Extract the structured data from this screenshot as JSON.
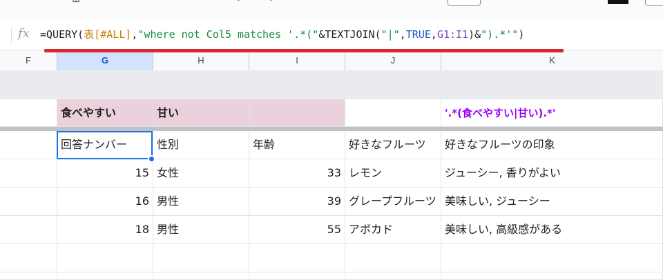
{
  "formula_bar": {
    "fx": "fx",
    "formula_parts": {
      "p1": "=QUERY(",
      "p2": "表[#ALL]",
      "p3": ",",
      "p4": "\"where not Col5 matches '.*(\"",
      "p5": "&TEXTJOIN(",
      "p6": "\"|\"",
      "p7": ",",
      "p8": "TRUE",
      "p9": ",",
      "p10": "G1:I1",
      "p11": ")&",
      "p12": "\").*'\"",
      "p13": ")"
    }
  },
  "columns": [
    "F",
    "G",
    "H",
    "I",
    "J",
    "K"
  ],
  "selected_column": "G",
  "frozen_row": {
    "G": "食べやすい",
    "H": "甘い",
    "I": "",
    "J": "",
    "K": "'.*(食べやすい|甘い).*'"
  },
  "headers": {
    "G": "回答ナンバー",
    "H": "性別",
    "I": "年齢",
    "J": "好きなフルーツ",
    "K": "好きなフルーツの印象"
  },
  "rows": [
    {
      "G": "15",
      "H": "女性",
      "I": "33",
      "J": "レモン",
      "K": "ジューシー, 香りがよい"
    },
    {
      "G": "16",
      "H": "男性",
      "I": "39",
      "J": "グレープフルーツ",
      "K": "美味しい, ジューシー"
    },
    {
      "G": "18",
      "H": "男性",
      "I": "55",
      "J": "アボカド",
      "K": "美味しい, 高級感がある"
    }
  ],
  "colors": {
    "header_pink": "#ead1dc",
    "formula_result_purple": "#9900ff",
    "annotation_red": "#d9262f",
    "selection_blue": "#1a73e8"
  }
}
